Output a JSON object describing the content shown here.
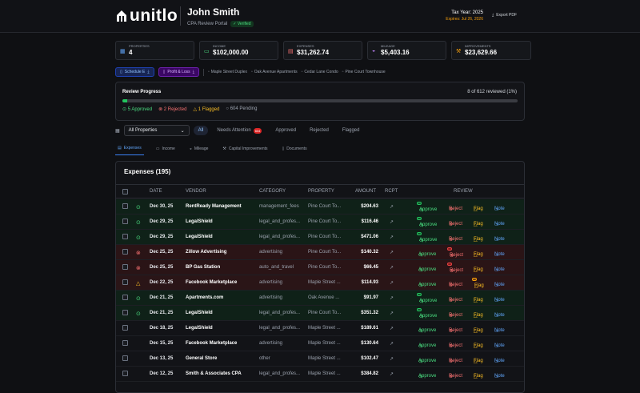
{
  "header": {
    "logo_text": "unitlo",
    "user_name": "John Smith",
    "portal_label": "CPA Review Portal",
    "verified_label": "Verified",
    "tax_year": "Tax Year: 2025",
    "expires": "Expires: Jul 26, 2026",
    "export_label": "Export PDF"
  },
  "stats": [
    {
      "label": "Properties",
      "value": "4",
      "icon": "building-icon"
    },
    {
      "label": "Income",
      "value": "$102,000.00",
      "icon": "cash-icon"
    },
    {
      "label": "Expenses",
      "value": "$31,262.74",
      "icon": "receipt-icon"
    },
    {
      "label": "Mileage",
      "value": "$5,403.16",
      "icon": "car-icon"
    },
    {
      "label": "Improvements",
      "value": "$23,629.66",
      "icon": "hammer-icon"
    }
  ],
  "filters": {
    "schedule_e": "Schedule E",
    "profit_loss": "Profit & Loss",
    "properties": [
      "Maple Street Duplex",
      "Oak Avenue Apartments",
      "Cedar Lane Condo",
      "Pine Court Townhouse"
    ]
  },
  "progress": {
    "title": "Review Progress",
    "count": "8 of 612 reviewed (1%)",
    "fraction": 0.013,
    "approved": "5 Approved",
    "rejected": "2 Rejected",
    "flagged": "1 Flagged",
    "pending": "604 Pending"
  },
  "toolbar": {
    "property_select": "All Properties",
    "all": "All",
    "needs_attention": "Needs Attention",
    "needs_attention_count": "604",
    "approved": "Approved",
    "rejected": "Rejected",
    "flagged": "Flagged"
  },
  "tabs": [
    "Expenses",
    "Income",
    "Mileage",
    "Capital Improvements",
    "Documents"
  ],
  "table": {
    "title": "Expenses (195)",
    "columns": {
      "date": "Date",
      "vendor": "Vendor",
      "category": "Category",
      "property": "Property",
      "amount": "Amount",
      "rcpt": "Rcpt",
      "review": "Review"
    },
    "actions": {
      "approve": "Approve",
      "reject": "Reject",
      "flag": "Flag",
      "note": "Note"
    },
    "rows": [
      {
        "status": "approved",
        "date": "Dec 30, 25",
        "vendor": "RentReady Management",
        "category": "management_fees",
        "property": "Pine Court To...",
        "amount": "$204.63"
      },
      {
        "status": "approved",
        "date": "Dec 29, 25",
        "vendor": "LegalShield",
        "category": "legal_and_profes...",
        "property": "Pine Court To...",
        "amount": "$116.46"
      },
      {
        "status": "approved",
        "date": "Dec 29, 25",
        "vendor": "LegalShield",
        "category": "legal_and_profes...",
        "property": "Pine Court To...",
        "amount": "$471.06"
      },
      {
        "status": "rejected",
        "date": "Dec 25, 25",
        "vendor": "Zillow Advertising",
        "category": "advertising",
        "property": "Pine Court To...",
        "amount": "$140.32"
      },
      {
        "status": "rejected",
        "date": "Dec 25, 25",
        "vendor": "BP Gas Station",
        "category": "auto_and_travel",
        "property": "Pine Court To...",
        "amount": "$66.45"
      },
      {
        "status": "flagged",
        "date": "Dec 22, 25",
        "vendor": "Facebook Marketplace",
        "category": "advertising",
        "property": "Maple Street ...",
        "amount": "$114.93"
      },
      {
        "status": "approved",
        "date": "Dec 21, 25",
        "vendor": "Apartments.com",
        "category": "advertising",
        "property": "Oak Avenue ...",
        "amount": "$91.97"
      },
      {
        "status": "approved",
        "date": "Dec 21, 25",
        "vendor": "LegalShield",
        "category": "legal_and_profes...",
        "property": "Pine Court To...",
        "amount": "$351.32"
      },
      {
        "status": "pending",
        "date": "Dec 18, 25",
        "vendor": "LegalShield",
        "category": "legal_and_profes...",
        "property": "Maple Street ...",
        "amount": "$189.61"
      },
      {
        "status": "pending",
        "date": "Dec 15, 25",
        "vendor": "Facebook Marketplace",
        "category": "advertising",
        "property": "Maple Street ...",
        "amount": "$130.64"
      },
      {
        "status": "pending",
        "date": "Dec 13, 25",
        "vendor": "General Store",
        "category": "other",
        "property": "Maple Street ...",
        "amount": "$102.47"
      },
      {
        "status": "pending",
        "date": "Dec 12, 25",
        "vendor": "Smith & Associates CPA",
        "category": "legal_and_profes...",
        "property": "Maple Street ...",
        "amount": "$384.82"
      }
    ]
  }
}
